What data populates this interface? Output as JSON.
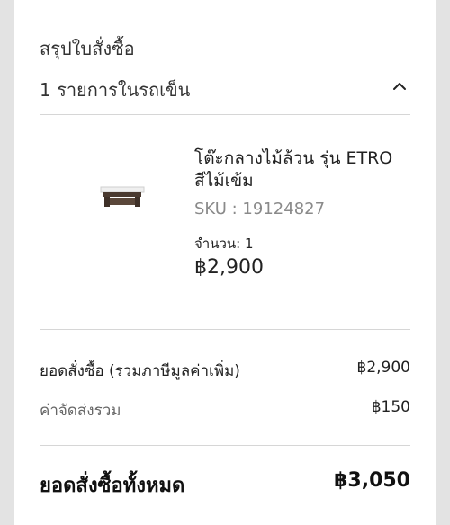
{
  "summary": {
    "title": "สรุปใบสั่งซื้อ",
    "cart_count": "1 รายการในรถเข็น",
    "toggle_icon": "chevron-up-icon"
  },
  "item": {
    "name": "โต๊ะกลางไม้ล้วน รุ่น ETRO สีไม้เข้ม",
    "sku": "SKU : 19124827",
    "quantity": "จำนวน: 1",
    "price": "฿2,900"
  },
  "totals": {
    "subtotal_label": "ยอดสั่งซื้อ (รวมภาษีมูลค่าเพิ่ม)",
    "subtotal_value": "฿2,900",
    "shipping_label": "ค่าจัดส่งรวม",
    "shipping_value": "฿150",
    "grand_label": "ยอดสั่งซื้อทั้งหมด",
    "grand_value": "฿3,050"
  }
}
